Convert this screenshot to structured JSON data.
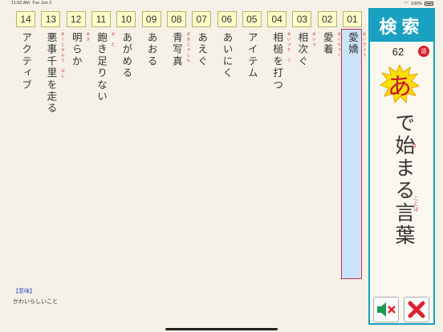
{
  "status_bar": {
    "time": "11:02 AM",
    "date": "Tue Jun 2",
    "battery": "100%"
  },
  "columns": [
    {
      "num": "01",
      "word": "愛嬌",
      "ruby": "あいきょう",
      "selected": true
    },
    {
      "num": "02",
      "word": "愛着",
      "ruby": "あいちゃく"
    },
    {
      "num": "03",
      "word": "相次ぐ",
      "ruby": "あいつ"
    },
    {
      "num": "04",
      "word": "相槌を打つ",
      "ruby": "あいづち　う"
    },
    {
      "num": "05",
      "word": "アイテム",
      "ruby": ""
    },
    {
      "num": "06",
      "word": "あいにく",
      "ruby": ""
    },
    {
      "num": "07",
      "word": "あえぐ",
      "ruby": ""
    },
    {
      "num": "08",
      "word": "青写真",
      "ruby": "あおじゃしん"
    },
    {
      "num": "09",
      "word": "あおる",
      "ruby": ""
    },
    {
      "num": "10",
      "word": "あがめる",
      "ruby": ""
    },
    {
      "num": "11",
      "word": "飽き足りない",
      "ruby": "あ　た"
    },
    {
      "num": "12",
      "word": "明らか",
      "ruby": "あき"
    },
    {
      "num": "13",
      "word": "悪事千里を走る",
      "ruby": "あくじせんり　はし"
    },
    {
      "num": "14",
      "word": "アクティブ",
      "ruby": ""
    }
  ],
  "meaning": {
    "label": "【意味】",
    "text": "かわいらしいこと"
  },
  "panel": {
    "title": "検索",
    "count": "62",
    "count_badge": "語",
    "initial": "あ",
    "phrase": "で始まる言葉",
    "furigana_ha": "は",
    "furigana_kotoba": "ことば"
  },
  "icons": {
    "sound": "mute-speaker-icon",
    "close": "close-x-icon"
  },
  "colors": {
    "accent": "#1aa0c0",
    "selected_fill": "#c9e4fb",
    "selected_border": "#c03050",
    "number_box": "#ffffc8",
    "close": "#e0202c",
    "sound": "#1a9a50"
  }
}
